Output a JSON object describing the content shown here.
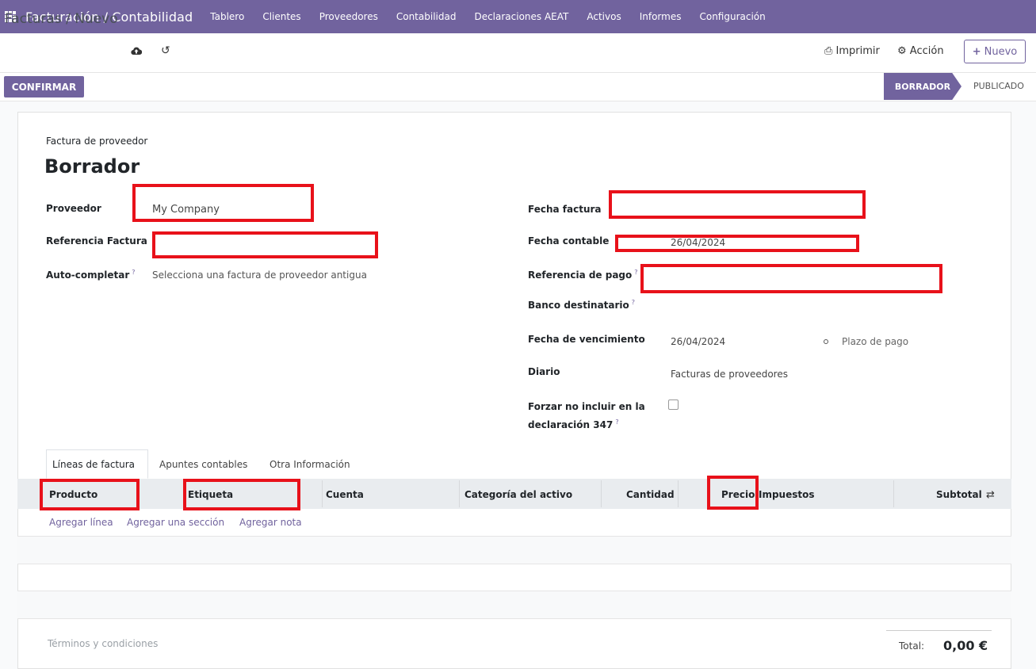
{
  "app": {
    "title": "Facturación / Contabilidad",
    "menu": [
      "Tablero",
      "Clientes",
      "Proveedores",
      "Contabilidad",
      "Declaraciones AEAT",
      "Activos",
      "Informes",
      "Configuración"
    ]
  },
  "control": {
    "breadcrumb": "Facturas / Nuevo",
    "print_label": "Imprimir",
    "action_label": "Acción",
    "new_label": "Nuevo",
    "confirm_label": "CONFIRMAR",
    "stages": [
      "BORRADOR",
      "PUBLICADO"
    ],
    "active_stage": "BORRADOR"
  },
  "form": {
    "doc_type": "Factura de proveedor",
    "doc_name": "Borrador",
    "left": {
      "supplier_label": "Proveedor",
      "supplier_value": "My Company",
      "ref_label": "Referencia Factura",
      "ref_value": "",
      "autocomplete_label": "Auto-completar",
      "autocomplete_placeholder": "Selecciona una factura de proveedor antigua"
    },
    "right": {
      "invoice_date_label": "Fecha factura",
      "invoice_date_value": "",
      "accounting_date_label": "Fecha contable",
      "accounting_date_value": "26/04/2024",
      "payment_ref_label": "Referencia de pago",
      "payment_ref_value": "",
      "bank_label": "Banco destinatario",
      "due_date_label": "Fecha de vencimiento",
      "due_date_value": "26/04/2024",
      "payment_terms_label": "Plazo de pago",
      "journal_label": "Diario",
      "journal_value": "Facturas de proveedores",
      "force_347_label_line1": "Forzar no incluir en la",
      "force_347_label_line2": "declaración 347",
      "force_347_checked": false
    },
    "help_mark": "?"
  },
  "tabs": [
    "Líneas de factura",
    "Apuntes contables",
    "Otra Información"
  ],
  "table": {
    "columns": [
      "Producto",
      "Etiqueta",
      "Cuenta",
      "Categoría del activo",
      "Cantidad",
      "Precio",
      "Impuestos",
      "Subtotal"
    ],
    "actions": [
      "Agregar línea",
      "Agregar una sección",
      "Agregar nota"
    ]
  },
  "footer": {
    "terms_placeholder": "Términos y condiciones",
    "total_label": "Total:",
    "total_value": "0,00 €"
  },
  "colors": {
    "brand": "#71639e",
    "highlight": "#e8111a"
  }
}
